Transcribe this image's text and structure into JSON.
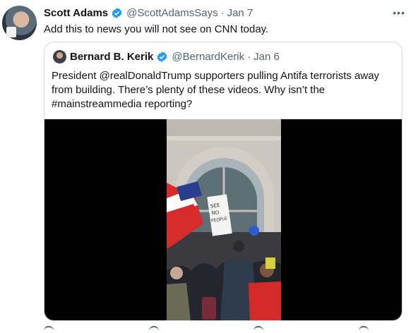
{
  "tweet": {
    "author_name": "Scott Adams",
    "author_handle": "@ScottAdamsSays",
    "separator": "·",
    "date": "Jan 7",
    "more_label": "•••",
    "text": "Add this to news you will not see on CNN today."
  },
  "quoted": {
    "author_name": "Bernard B. Kerik",
    "author_handle": "@BernardKerik",
    "separator": "·",
    "date": "Jan 6",
    "text": "President @realDonaldTrump supporters pulling Antifa terrorists away from building. There’s plenty of these videos. Why isn’t the #mainstreammedia reporting?",
    "video_sign": "SEE\nNO\nPEOPLE\nVOTING"
  },
  "colors": {
    "verified": "#1d9bf0",
    "muted": "#536471",
    "border": "#cfd9de"
  }
}
